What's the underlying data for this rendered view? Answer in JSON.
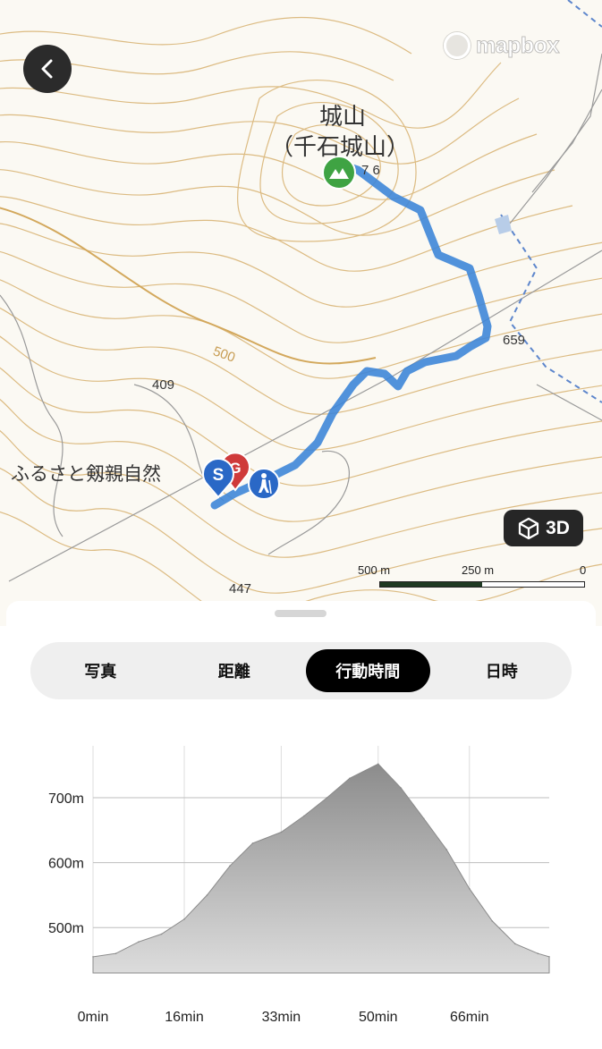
{
  "map": {
    "attribution": "mapbox",
    "peak_name": "城山",
    "peak_alt_name": "（千石城山）",
    "peak_elevation": "7 6",
    "place_label": "ふるさと剱親自然",
    "contour_label": "500",
    "elevations": [
      "659",
      "409",
      "447"
    ],
    "view_3d_label": "3D",
    "scale_labels": [
      "500 m",
      "250 m",
      "0"
    ],
    "start_marker": "S",
    "goal_marker": "G",
    "colors": {
      "route": "#3e86d8",
      "peak_marker": "#3fa343",
      "start_marker": "#2a68c6",
      "goal_marker": "#cf3a3a",
      "contour": "#d9b87a"
    }
  },
  "tabs": [
    {
      "label": "写真",
      "active": false
    },
    {
      "label": "距離",
      "active": false
    },
    {
      "label": "行動時間",
      "active": true
    },
    {
      "label": "日時",
      "active": false
    }
  ],
  "chart_data": {
    "type": "area",
    "x": [
      0,
      4,
      8,
      12,
      16,
      20,
      24,
      28,
      33,
      37,
      41,
      45,
      50,
      54,
      58,
      62,
      66,
      70,
      74,
      78,
      80
    ],
    "values": [
      455,
      460,
      478,
      490,
      513,
      550,
      595,
      630,
      647,
      672,
      700,
      730,
      752,
      715,
      668,
      620,
      560,
      510,
      475,
      460,
      455
    ],
    "x_tick_labels": [
      "0min",
      "16min",
      "33min",
      "50min",
      "66min"
    ],
    "x_ticks": [
      0,
      16,
      33,
      50,
      66
    ],
    "y_tick_labels": [
      "500m",
      "600m",
      "700m"
    ],
    "y_ticks": [
      500,
      600,
      700
    ],
    "ylim": [
      430,
      780
    ],
    "xlim": [
      0,
      80
    ],
    "title": "",
    "xlabel": "",
    "ylabel": "",
    "grid": true
  }
}
